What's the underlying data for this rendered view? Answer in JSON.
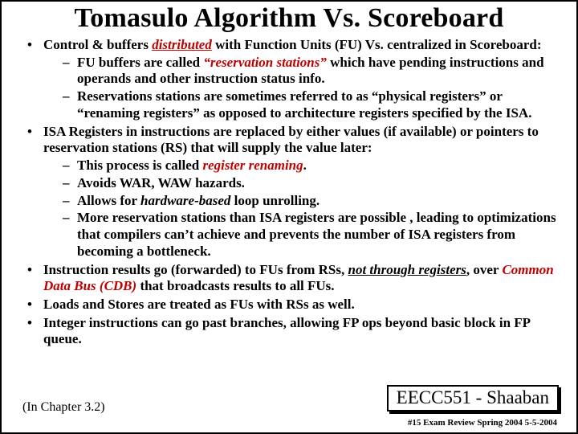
{
  "title": "Tomasulo Algorithm Vs. Scoreboard",
  "b1": {
    "pre": "Control & buffers ",
    "kw": "distributed",
    "post": " with Function Units (FU) Vs. centralized in Scoreboard:",
    "s1": {
      "pre": "FU buffers are called ",
      "kw": "“reservation stations”",
      "post": " which have pending instructions and operands and other instruction status info."
    },
    "s2": "Reservations stations are sometimes referred  to as “physical registers”  or “renaming registers”  as opposed to architecture registers specified by the ISA."
  },
  "b2": {
    "text": "ISA Registers in instructions are replaced by either values (if available) or pointers to reservation stations (RS) that will supply the value later:",
    "s1": {
      "pre": "This process is called ",
      "kw": "register renaming",
      "post": "."
    },
    "s2": "Avoids WAR, WAW hazards.",
    "s3": {
      "pre": "Allows for ",
      "kw": "hardware-based",
      "post": " loop unrolling."
    },
    "s4": "More reservation stations than ISA registers are possible ,  leading to optimizations that compilers can’t achieve and prevents the number of ISA registers from becoming a bottleneck."
  },
  "b3": {
    "pre": "Instruction results go (forwarded) to FUs from RSs, ",
    "kw1": "not through registers",
    "mid": ", over ",
    "kw2": "Common Data Bus (CDB)",
    "post": " that broadcasts results to all FUs."
  },
  "b4": "Loads and Stores are treated as FUs with RSs as well.",
  "b5": "Integer instructions can go past branches, allowing FP ops beyond basic block in FP queue.",
  "chapter": "(In Chapter 3.2)",
  "course": "EECC551 - Shaaban",
  "footer": "#15  Exam Review  Spring 2004  5-5-2004"
}
